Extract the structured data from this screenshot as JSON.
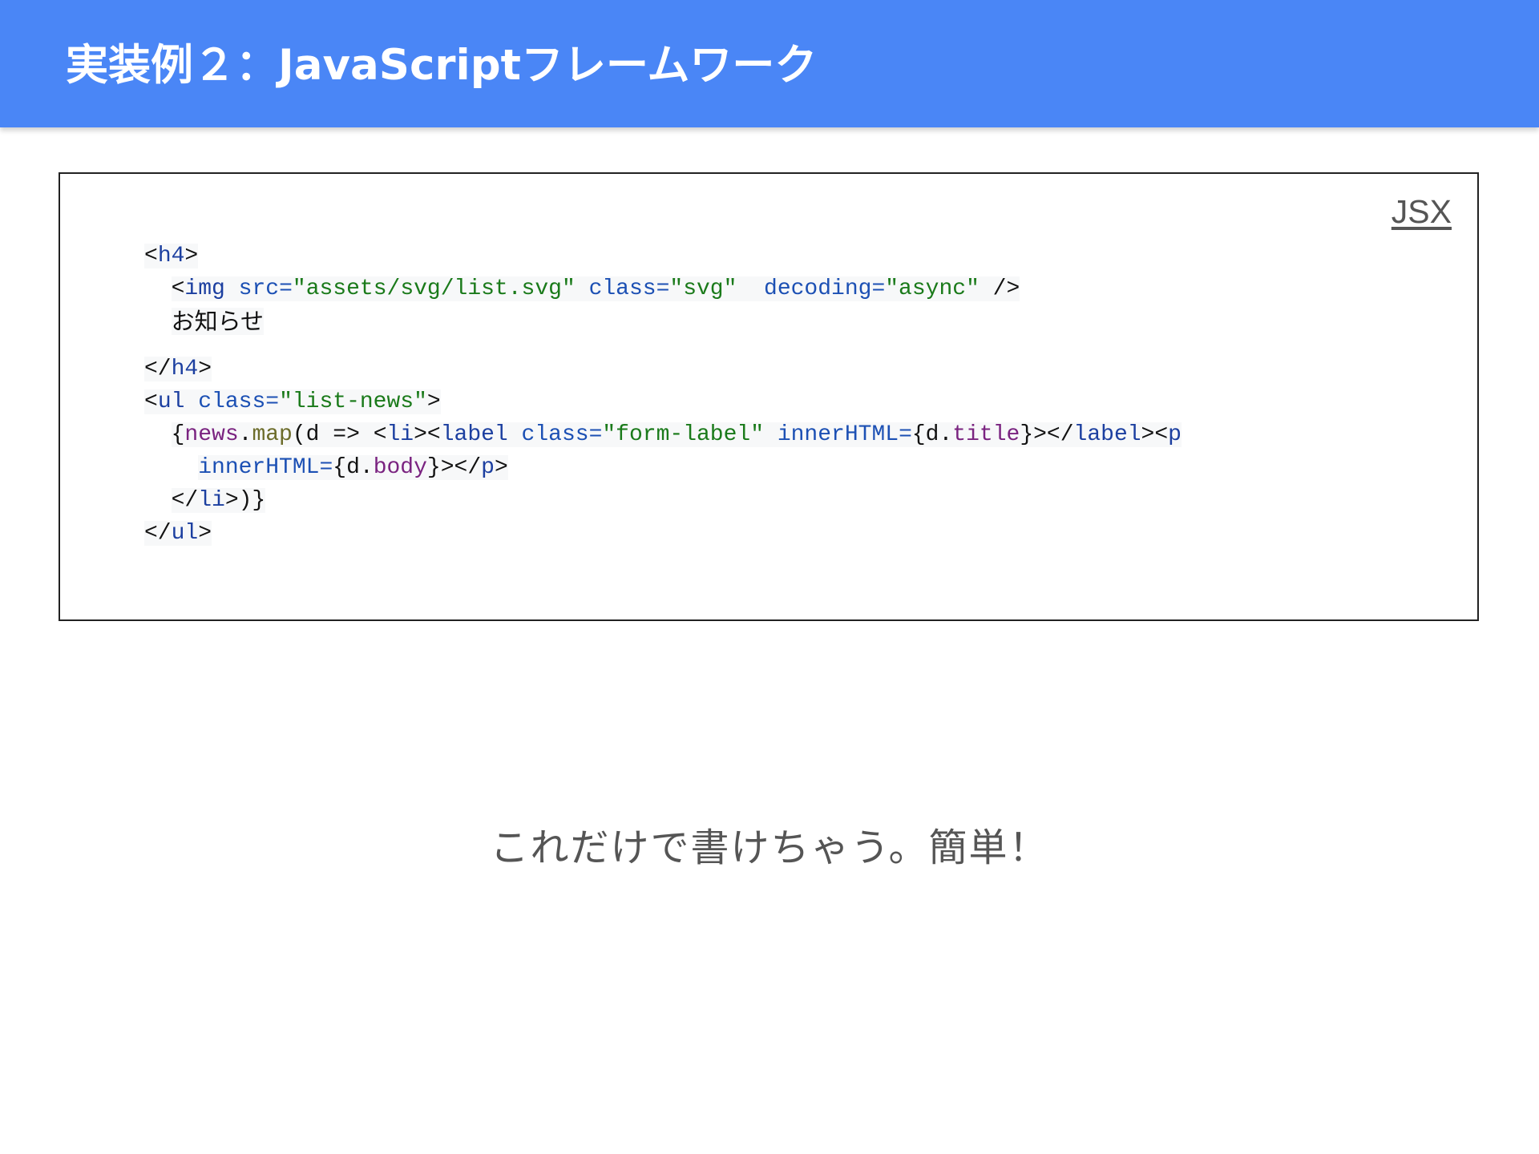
{
  "slide": {
    "title": "実装例２：JavaScriptフレームワーク",
    "caption": "これだけで書けちゃう。簡単！"
  },
  "code_block": {
    "language_label": "JSX",
    "lines": [
      {
        "indent": "",
        "tokens": [
          {
            "t": "<",
            "c": "pun"
          },
          {
            "t": "h4",
            "c": "tag"
          },
          {
            "t": ">",
            "c": "pun"
          }
        ]
      },
      {
        "indent": "  ",
        "tokens": [
          {
            "t": "<",
            "c": "pun"
          },
          {
            "t": "img",
            "c": "tag"
          },
          {
            "t": " ",
            "c": "pun"
          },
          {
            "t": "src",
            "c": "attr"
          },
          {
            "t": "=",
            "c": "attr"
          },
          {
            "t": "\"assets/svg/list.svg\"",
            "c": "str"
          },
          {
            "t": " ",
            "c": "pun"
          },
          {
            "t": "class",
            "c": "attr"
          },
          {
            "t": "=",
            "c": "attr"
          },
          {
            "t": "\"svg\"",
            "c": "str"
          },
          {
            "t": "  ",
            "c": "pun"
          },
          {
            "t": "decoding",
            "c": "attr"
          },
          {
            "t": "=",
            "c": "attr"
          },
          {
            "t": "\"async\"",
            "c": "str"
          },
          {
            "t": " />",
            "c": "pun"
          }
        ]
      },
      {
        "indent": "  ",
        "jp": true,
        "tokens": [
          {
            "t": "お知らせ",
            "c": "pun"
          }
        ]
      },
      {
        "indent": "",
        "gap": true,
        "tokens": [
          {
            "t": "</",
            "c": "pun"
          },
          {
            "t": "h4",
            "c": "tag"
          },
          {
            "t": ">",
            "c": "pun"
          }
        ]
      },
      {
        "indent": "",
        "tokens": [
          {
            "t": "<",
            "c": "pun"
          },
          {
            "t": "ul",
            "c": "tag"
          },
          {
            "t": " ",
            "c": "pun"
          },
          {
            "t": "class",
            "c": "attr"
          },
          {
            "t": "=",
            "c": "attr"
          },
          {
            "t": "\"list-news\"",
            "c": "str"
          },
          {
            "t": ">",
            "c": "pun"
          }
        ]
      },
      {
        "indent": "  ",
        "tokens": [
          {
            "t": "{",
            "c": "pun"
          },
          {
            "t": "news",
            "c": "var"
          },
          {
            "t": ".",
            "c": "pun"
          },
          {
            "t": "map",
            "c": "fn"
          },
          {
            "t": "(d => <",
            "c": "pun"
          },
          {
            "t": "li",
            "c": "tag"
          },
          {
            "t": "><",
            "c": "pun"
          },
          {
            "t": "label",
            "c": "tag"
          },
          {
            "t": " ",
            "c": "pun"
          },
          {
            "t": "class",
            "c": "attr"
          },
          {
            "t": "=",
            "c": "attr"
          },
          {
            "t": "\"form-label\"",
            "c": "str"
          },
          {
            "t": " ",
            "c": "pun"
          },
          {
            "t": "innerHTML",
            "c": "attr"
          },
          {
            "t": "=",
            "c": "attr"
          },
          {
            "t": "{d.",
            "c": "pun"
          },
          {
            "t": "title",
            "c": "var"
          },
          {
            "t": "}></",
            "c": "pun"
          },
          {
            "t": "label",
            "c": "tag"
          },
          {
            "t": "><",
            "c": "pun"
          },
          {
            "t": "p",
            "c": "tag"
          }
        ]
      },
      {
        "indent": "    ",
        "tokens": [
          {
            "t": "innerHTML",
            "c": "attr"
          },
          {
            "t": "=",
            "c": "attr"
          },
          {
            "t": "{d.",
            "c": "pun"
          },
          {
            "t": "body",
            "c": "var"
          },
          {
            "t": "}></",
            "c": "pun"
          },
          {
            "t": "p",
            "c": "tag"
          },
          {
            "t": ">",
            "c": "pun"
          }
        ]
      },
      {
        "indent": "  ",
        "tokens": [
          {
            "t": "</",
            "c": "pun"
          },
          {
            "t": "li",
            "c": "tag"
          },
          {
            "t": ">)}",
            "c": "pun"
          }
        ]
      },
      {
        "indent": "",
        "tokens": [
          {
            "t": "</",
            "c": "pun"
          },
          {
            "t": "ul",
            "c": "tag"
          },
          {
            "t": ">",
            "c": "pun"
          }
        ]
      }
    ]
  },
  "colors": {
    "header_background": "#4a86f6",
    "tag": "#1c3fa0",
    "attribute": "#1c50b4",
    "string": "#1a7a1a",
    "variable": "#7a2380",
    "function": "#6c6c2a"
  }
}
